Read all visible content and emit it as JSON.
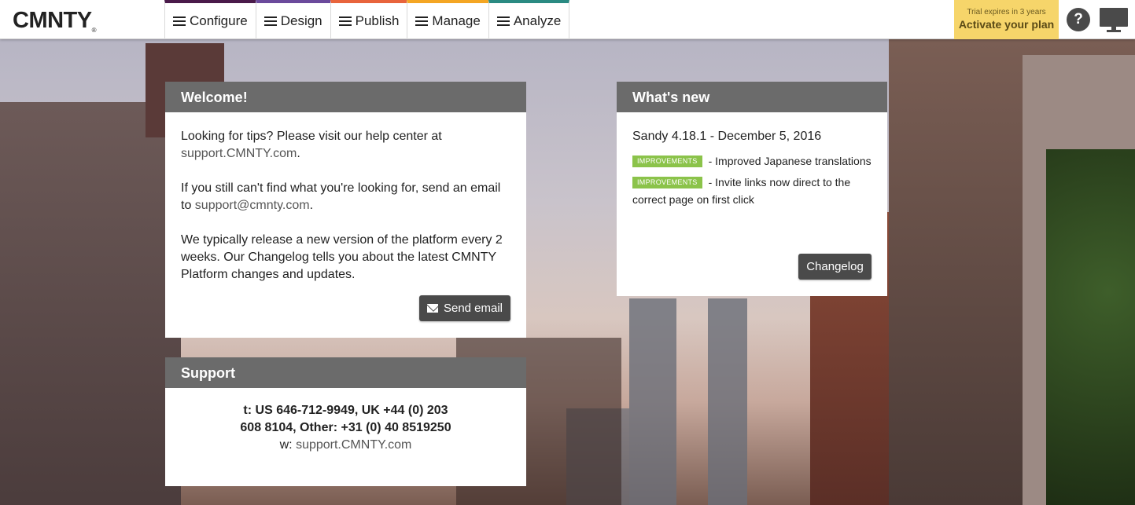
{
  "header": {
    "logo": "CMNTY",
    "logo_mark": "®",
    "tabs": [
      {
        "label": "Configure",
        "color": "#4a1a4a"
      },
      {
        "label": "Design",
        "color": "#6b4a9c"
      },
      {
        "label": "Publish",
        "color": "#e8643c"
      },
      {
        "label": "Manage",
        "color": "#f4a623"
      },
      {
        "label": "Analyze",
        "color": "#2a8a82"
      }
    ],
    "trial_notice": "Trial expires in 3 years",
    "activate_label": "Activate your plan",
    "help_label": "?",
    "icons": {
      "menu": "hamburger-icon",
      "help": "help-circle-icon",
      "screen": "monitor-icon"
    }
  },
  "welcome": {
    "title": "Welcome!",
    "p1_text": "Looking for tips? Please visit our help center at",
    "p1_link": "support.CMNTY.com",
    "p1_end": ".",
    "p2_text": "If you still can't find what you're looking for, send an email to",
    "p2_link": "support@cmnty.com",
    "p2_end": ".",
    "p3_text": "We typically release a new version of the platform every 2 weeks. Our Changelog tells you about the latest CMNTY Platform changes and updates.",
    "button": "Send email",
    "button_icon": "mail-icon"
  },
  "support": {
    "title": "Support",
    "phone_text": "t: US 646-712-9949, UK +44 (0) 203 608 8104, Other: +31 (0) 40 8519250",
    "web_prefix": "w:",
    "web_link": "support.CMNTY.com"
  },
  "whatsnew": {
    "title": "What's new",
    "version": "Sandy 4.18.1 - December 5, 2016",
    "items": [
      {
        "badge": "IMPROVEMENTS",
        "text": "- Improved Japanese translations"
      },
      {
        "badge": "IMPROVEMENTS",
        "text": "- Invite links now direct to the correct page on first click"
      }
    ],
    "button": "Changelog"
  }
}
